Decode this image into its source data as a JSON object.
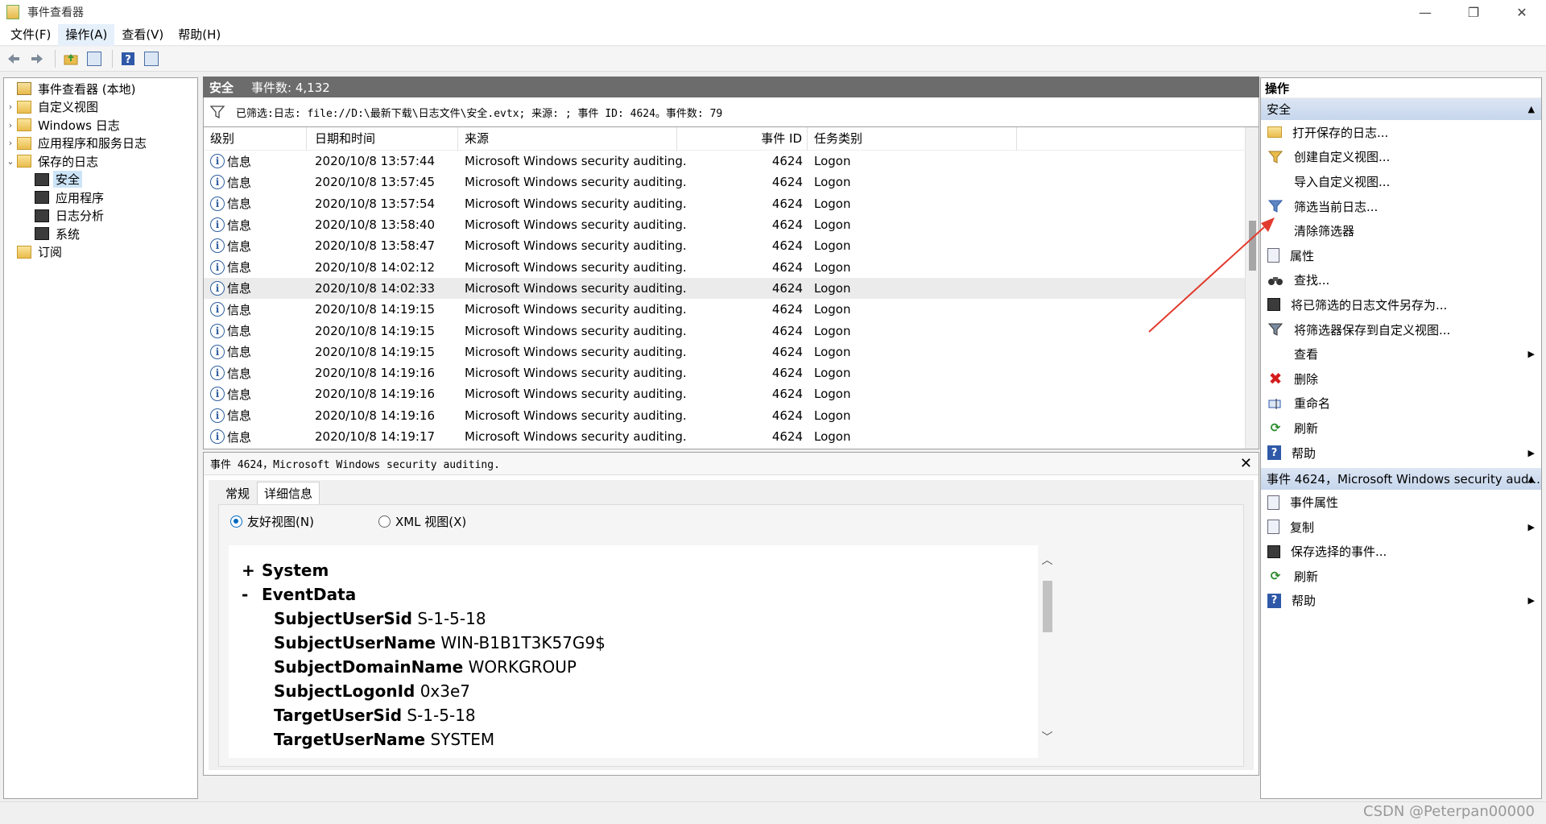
{
  "window": {
    "title": "事件查看器",
    "controls": [
      "—",
      "❐",
      "✕"
    ]
  },
  "menu": [
    {
      "label": "文件(F)",
      "active": false
    },
    {
      "label": "操作(A)",
      "active": true
    },
    {
      "label": "查看(V)",
      "active": false
    },
    {
      "label": "帮助(H)",
      "active": false
    }
  ],
  "tree": {
    "root": "事件查看器 (本地)",
    "custom_views": "自定义视图",
    "windows_logs": "Windows 日志",
    "app_service_logs": "应用程序和服务日志",
    "saved_logs": "保存的日志",
    "saved_children": [
      "安全",
      "应用程序",
      "日志分析",
      "系统"
    ],
    "subscriptions": "订阅"
  },
  "log": {
    "name": "安全",
    "event_count": "事件数: 4,132",
    "filter_text": "已筛选:日志: file://D:\\最新下载\\日志文件\\安全.evtx; 来源: ; 事件 ID: 4624。事件数: 79"
  },
  "grid": {
    "columns": [
      "级别",
      "日期和时间",
      "来源",
      "事件 ID",
      "任务类别"
    ],
    "rows": [
      {
        "level": "信息",
        "datetime": "2020/10/8 13:57:44",
        "source": "Microsoft Windows security auditing.",
        "id": "4624",
        "category": "Logon"
      },
      {
        "level": "信息",
        "datetime": "2020/10/8 13:57:45",
        "source": "Microsoft Windows security auditing.",
        "id": "4624",
        "category": "Logon"
      },
      {
        "level": "信息",
        "datetime": "2020/10/8 13:57:54",
        "source": "Microsoft Windows security auditing.",
        "id": "4624",
        "category": "Logon"
      },
      {
        "level": "信息",
        "datetime": "2020/10/8 13:58:40",
        "source": "Microsoft Windows security auditing.",
        "id": "4624",
        "category": "Logon"
      },
      {
        "level": "信息",
        "datetime": "2020/10/8 13:58:47",
        "source": "Microsoft Windows security auditing.",
        "id": "4624",
        "category": "Logon"
      },
      {
        "level": "信息",
        "datetime": "2020/10/8 14:02:12",
        "source": "Microsoft Windows security auditing.",
        "id": "4624",
        "category": "Logon"
      },
      {
        "level": "信息",
        "datetime": "2020/10/8 14:02:33",
        "source": "Microsoft Windows security auditing.",
        "id": "4624",
        "category": "Logon"
      },
      {
        "level": "信息",
        "datetime": "2020/10/8 14:19:15",
        "source": "Microsoft Windows security auditing.",
        "id": "4624",
        "category": "Logon"
      },
      {
        "level": "信息",
        "datetime": "2020/10/8 14:19:15",
        "source": "Microsoft Windows security auditing.",
        "id": "4624",
        "category": "Logon"
      },
      {
        "level": "信息",
        "datetime": "2020/10/8 14:19:15",
        "source": "Microsoft Windows security auditing.",
        "id": "4624",
        "category": "Logon"
      },
      {
        "level": "信息",
        "datetime": "2020/10/8 14:19:16",
        "source": "Microsoft Windows security auditing.",
        "id": "4624",
        "category": "Logon"
      },
      {
        "level": "信息",
        "datetime": "2020/10/8 14:19:16",
        "source": "Microsoft Windows security auditing.",
        "id": "4624",
        "category": "Logon"
      },
      {
        "level": "信息",
        "datetime": "2020/10/8 14:19:16",
        "source": "Microsoft Windows security auditing.",
        "id": "4624",
        "category": "Logon"
      },
      {
        "level": "信息",
        "datetime": "2020/10/8 14:19:17",
        "source": "Microsoft Windows security auditing.",
        "id": "4624",
        "category": "Logon"
      }
    ],
    "highlighted_row": 6
  },
  "detail": {
    "title": "事件 4624，Microsoft Windows security auditing.",
    "close": "✕",
    "tabs": [
      "常规",
      "详细信息"
    ],
    "active_tab": 1,
    "radio_friendly": "友好视图(N)",
    "radio_xml": "XML 视图(X)",
    "system_toggle": "+",
    "system_label": "System",
    "eventdata_toggle": "-",
    "eventdata_label": "EventData",
    "fields": [
      {
        "key": "SubjectUserSid",
        "value": "S-1-5-18"
      },
      {
        "key": "SubjectUserName",
        "value": "WIN-B1B1T3K57G9$"
      },
      {
        "key": "SubjectDomainName",
        "value": "WORKGROUP"
      },
      {
        "key": "SubjectLogonId",
        "value": "0x3e7"
      },
      {
        "key": "TargetUserSid",
        "value": "S-1-5-18"
      },
      {
        "key": "TargetUserName",
        "value": "SYSTEM"
      }
    ]
  },
  "actions": {
    "title": "操作",
    "group1": "安全",
    "group1_items": [
      {
        "label": "打开保存的日志...",
        "icon": "folder-open-icon",
        "sub": ""
      },
      {
        "label": "创建自定义视图...",
        "icon": "funnel-star-icon",
        "sub": ""
      },
      {
        "label": "导入自定义视图...",
        "icon": "blank",
        "sub": ""
      },
      {
        "label": "筛选当前日志...",
        "icon": "funnel-icon",
        "sub": ""
      },
      {
        "label": "清除筛选器",
        "icon": "blank",
        "sub": ""
      },
      {
        "label": "属性",
        "icon": "page-icon",
        "sub": ""
      },
      {
        "label": "查找...",
        "icon": "binoculars-icon",
        "sub": ""
      },
      {
        "label": "将已筛选的日志文件另存为...",
        "icon": "disk-icon",
        "sub": ""
      },
      {
        "label": "将筛选器保存到自定义视图...",
        "icon": "funnel-save-icon",
        "sub": ""
      },
      {
        "label": "查看",
        "icon": "blank",
        "sub": "▶"
      },
      {
        "label": "删除",
        "icon": "delete-icon",
        "sub": ""
      },
      {
        "label": "重命名",
        "icon": "rename-icon",
        "sub": ""
      },
      {
        "label": "刷新",
        "icon": "refresh-icon",
        "sub": ""
      },
      {
        "label": "帮助",
        "icon": "help-icon",
        "sub": "▶"
      }
    ],
    "group2": "事件 4624，Microsoft Windows security aud...",
    "group2_items": [
      {
        "label": "事件属性",
        "icon": "page-icon",
        "sub": ""
      },
      {
        "label": "复制",
        "icon": "copy-icon",
        "sub": "▶"
      },
      {
        "label": "保存选择的事件...",
        "icon": "disk-icon",
        "sub": ""
      },
      {
        "label": "刷新",
        "icon": "refresh-icon",
        "sub": ""
      },
      {
        "label": "帮助",
        "icon": "help-icon",
        "sub": "▶"
      }
    ]
  },
  "watermark": "CSDN @Peterpan00000",
  "colors": {
    "accent": "#0067c0",
    "header_gray": "#6c6c6c",
    "group_blue": "#c6d6ec",
    "annotation_red": "#e23b2e"
  }
}
